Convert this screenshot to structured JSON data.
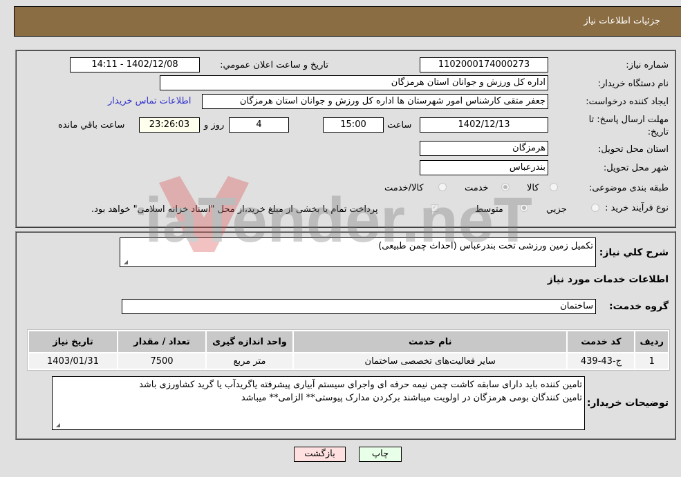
{
  "header": {
    "title": "جزئیات اطلاعات نیاز"
  },
  "colors": {
    "header_bg": "#8b6d44",
    "back_button_bg": "#ffe0e0",
    "print_button_bg": "#e8ffe8",
    "link": "#3333cc"
  },
  "form": {
    "need_number": {
      "label": "شماره نیاز:",
      "value": "1102000174000273"
    },
    "announce_datetime": {
      "label": "تاریخ و ساعت اعلان عمومي:",
      "value": "1402/12/08 - 14:11"
    },
    "buyer_org": {
      "label": "نام دستگاه خریدار:",
      "value": "اداره کل ورزش و جوانان استان هرمزگان"
    },
    "requester": {
      "label": "ایجاد کننده درخواست:",
      "value": "جعفر متقی کارشناس امور شهرستان ها اداره کل ورزش و جوانان استان هرمزگان",
      "contact_link": "اطلاعات تماس خریدار"
    },
    "deadline": {
      "label": "مهلت ارسال پاسخ: تا تاریخ:",
      "date": "1402/12/13",
      "time_label": "ساعت",
      "time": "15:00",
      "days": "4",
      "days_label": "روز و",
      "remaining": "23:26:03",
      "remaining_label": "ساعت باقي مانده"
    },
    "province": {
      "label": "استان محل تحویل:",
      "value": "هرمزگان"
    },
    "city": {
      "label": "شهر محل تحویل:",
      "value": "بندرعباس"
    },
    "category": {
      "label": "طبقه بندی موضوعی:",
      "options": [
        {
          "label": "کالا",
          "checked": false
        },
        {
          "label": "خدمت",
          "checked": true
        },
        {
          "label": "کالا/خدمت",
          "checked": false
        }
      ]
    },
    "purchase_type": {
      "label": "نوع فرآیند خرید :",
      "options": [
        {
          "label": "جزيي",
          "checked": false
        },
        {
          "label": "متوسط",
          "checked": true
        }
      ],
      "treasury_note": "پرداخت تمام یا بخشی از مبلغ خرید،از محل \"اسناد خزانه اسلامی\" خواهد بود."
    }
  },
  "details": {
    "summary_label": "شرح کلي نياز:",
    "summary_value": "تکمیل زمین ورزشی تخت بندرعباس (احداث چمن طبیعی)",
    "services_heading": "اطلاعات خدمات مورد نياز",
    "service_group_label": "گروه خدمت:",
    "service_group_value": "ساختمان",
    "table": {
      "headers": [
        "رديف",
        "کد خدمت",
        "نام خدمت",
        "واحد اندازه گيری",
        "تعداد / مقدار",
        "تاریخ نیاز"
      ],
      "rows": [
        [
          "1",
          "ج-43-439",
          "سایر فعالیت‌های تخصصی ساختمان",
          "متر مربع",
          "7500",
          "1403/01/31"
        ]
      ]
    },
    "buyer_notes_label": "توضيحات خريدار:",
    "buyer_notes_lines": [
      "تامین کننده باید دارای سابقه کاشت چمن نیمه حرفه ای واجرای سیستم آبیاری پیشرفته یاگریدآب یا گرید کشاورزی باشد",
      "تامین کنندگان بومی هرمزگان در اولویت میباشند برکردن مدارک پیوستی** الزامی** میباشد"
    ]
  },
  "buttons": {
    "print": "چاپ",
    "back": "بازگشت"
  },
  "watermark": {
    "text": "AriaTender.neT"
  }
}
